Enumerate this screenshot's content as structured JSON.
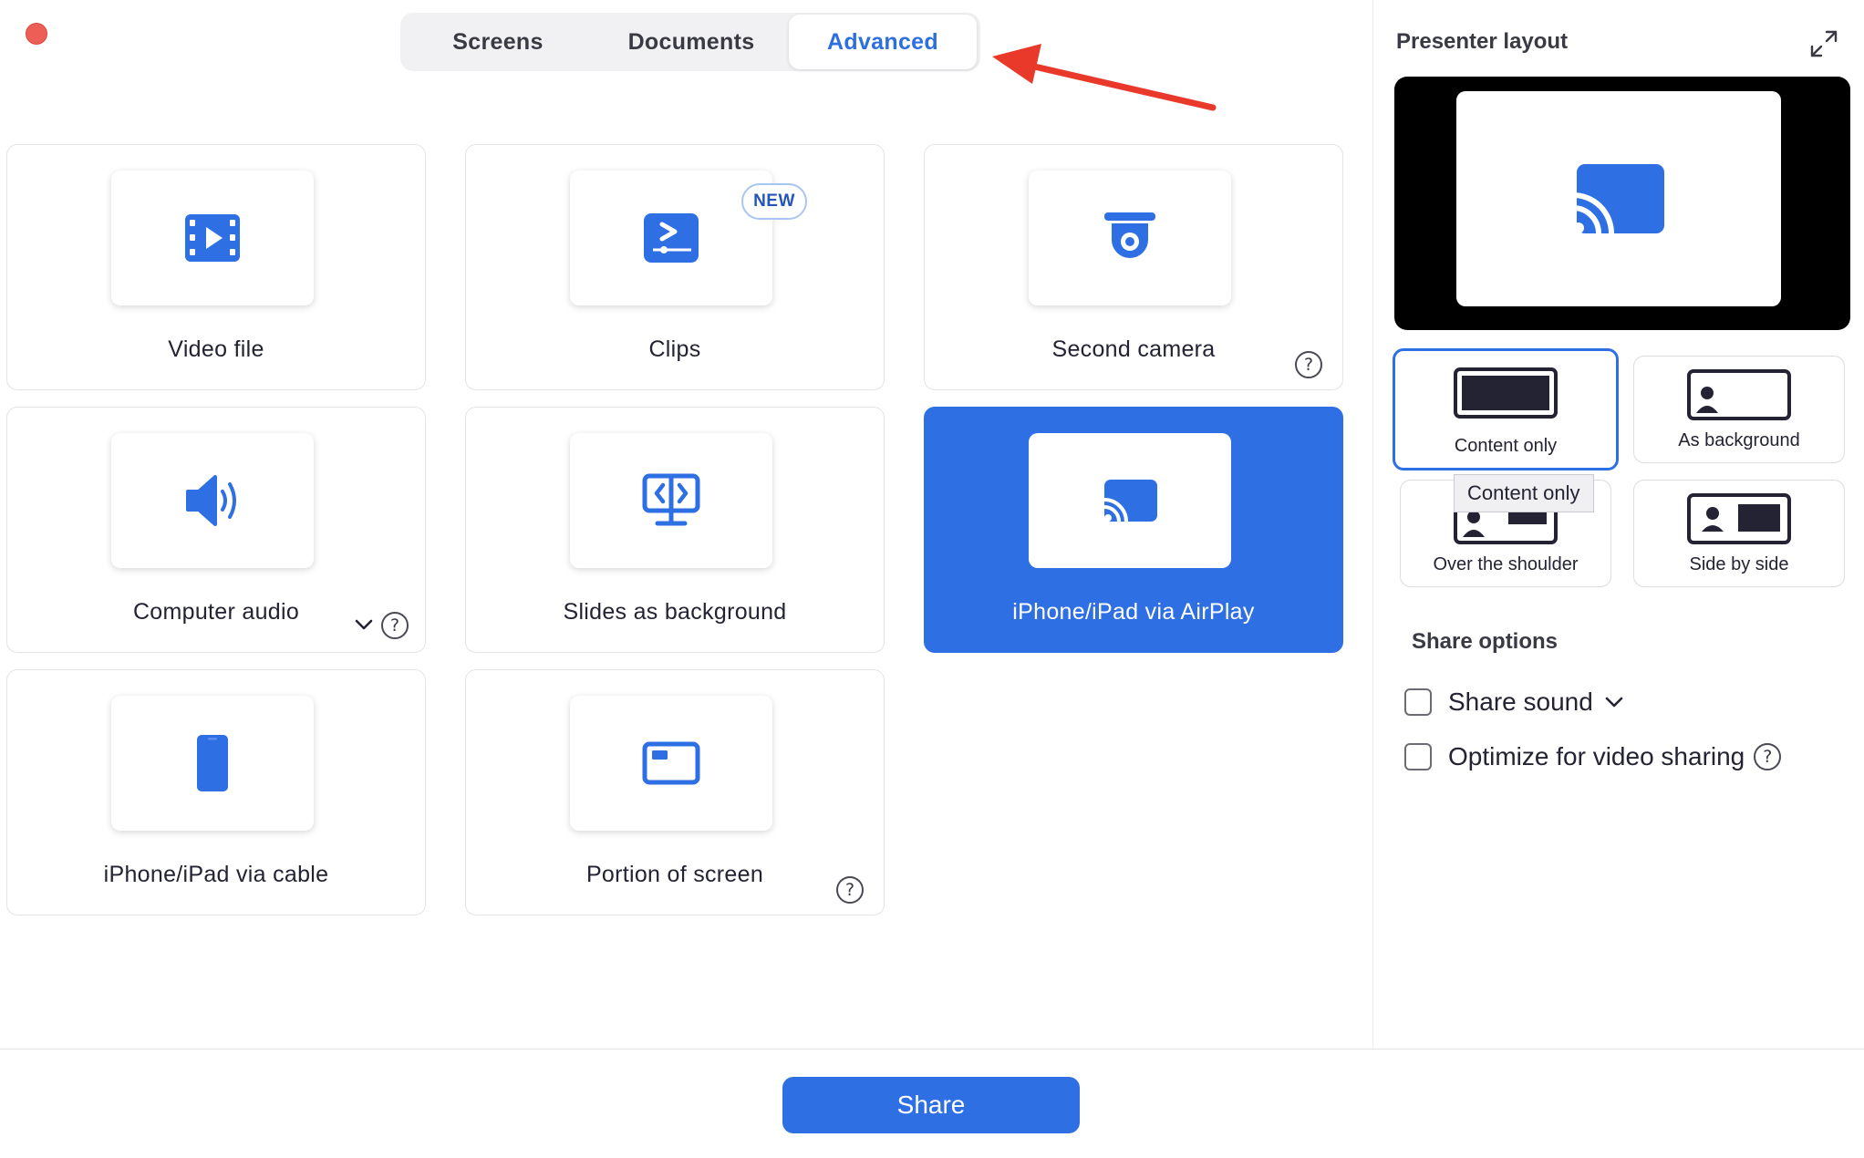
{
  "tabs": {
    "screens": "Screens",
    "documents": "Documents",
    "advanced": "Advanced",
    "active": "Advanced"
  },
  "options": {
    "video_file": "Video file",
    "clips": "Clips",
    "clips_badge": "NEW",
    "second_camera": "Second camera",
    "computer_audio": "Computer audio",
    "slides_as_background": "Slides as background",
    "iphone_airplay": "iPhone/iPad via AirPlay",
    "iphone_cable": "iPhone/iPad via cable",
    "portion_of_screen": "Portion of screen",
    "selected": "iPhone/iPad via AirPlay"
  },
  "panel": {
    "title": "Presenter layout",
    "layouts": {
      "content_only": "Content only",
      "as_background": "As background",
      "over_the_shoulder": "Over the shoulder",
      "side_by_side": "Side by side",
      "selected": "Content only"
    },
    "tooltip": "Content only",
    "share_options_title": "Share options",
    "share_sound": "Share sound",
    "optimize_video": "Optimize for video sharing"
  },
  "footer": {
    "share_button": "Share"
  },
  "colors": {
    "accent": "#2f6fe4",
    "close_dot": "#ec5e56",
    "annotation_arrow": "#e8392b"
  },
  "icons": {
    "help": "?"
  }
}
